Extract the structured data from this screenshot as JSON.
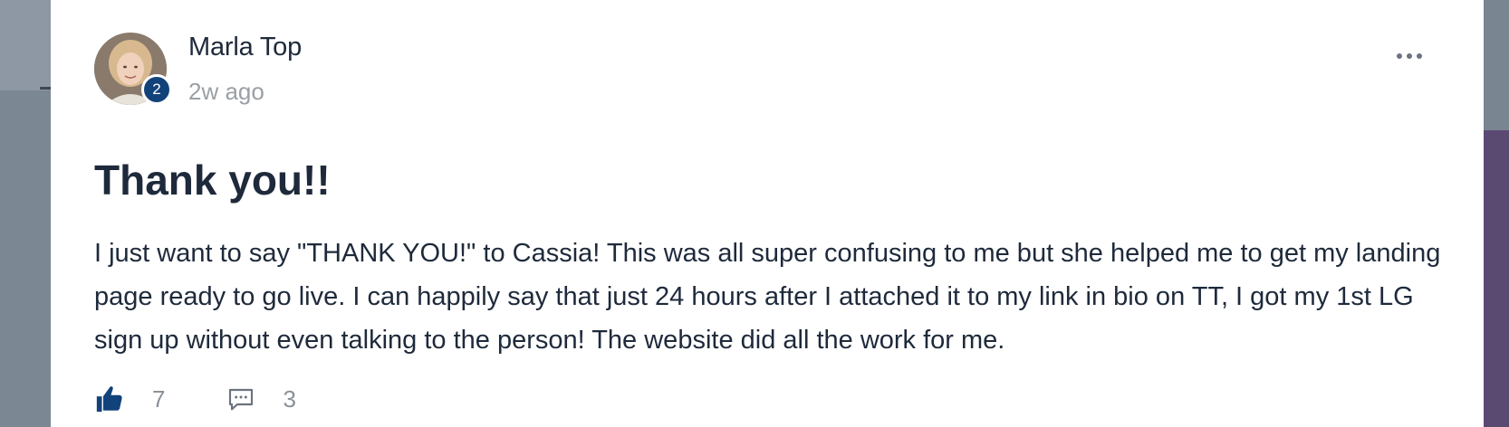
{
  "post": {
    "author": {
      "name": "Marla Top",
      "level": "2"
    },
    "time": "2w ago",
    "title": "Thank you!!",
    "body": "I just want to say \"THANK YOU!\" to Cassia! This was all super confusing to me but she helped me to get my landing page ready to go live. I can happily say that just 24 hours after I attached it to my link in bio on TT, I got my 1st LG sign up without even talking to the person! The website did all the work for me.",
    "likes": "7",
    "comments": "3"
  },
  "icons": {
    "menu": "more-horizontal-icon",
    "like": "thumbs-up-icon",
    "comment": "comment-icon"
  },
  "colors": {
    "badge": "#12427a",
    "like_icon": "#12427a",
    "text": "#1e2a3b",
    "muted": "#9aa0a6"
  }
}
